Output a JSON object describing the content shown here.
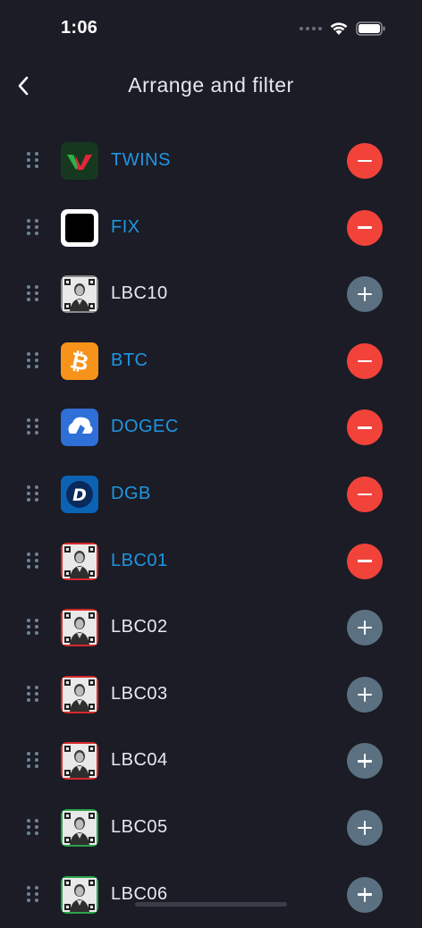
{
  "status": {
    "time": "1:06"
  },
  "header": {
    "title": "Arrange and filter"
  },
  "colors": {
    "active_text": "#1f96e3",
    "remove": "#f2433a",
    "add": "#5b7181",
    "background": "#1b1c26"
  },
  "coins": [
    {
      "name": "TWINS",
      "active": true,
      "icon": "twins-logo"
    },
    {
      "name": "FIX",
      "active": true,
      "icon": "fix-logo"
    },
    {
      "name": "LBC10",
      "active": false,
      "icon": "lbc-portrait"
    },
    {
      "name": "BTC",
      "active": true,
      "icon": "bitcoin-logo"
    },
    {
      "name": "DOGEC",
      "active": true,
      "icon": "dogec-logo"
    },
    {
      "name": "DGB",
      "active": true,
      "icon": "digibyte-logo"
    },
    {
      "name": "LBC01",
      "active": true,
      "icon": "lbc-portrait"
    },
    {
      "name": "LBC02",
      "active": false,
      "icon": "lbc-portrait"
    },
    {
      "name": "LBC03",
      "active": false,
      "icon": "lbc-portrait"
    },
    {
      "name": "LBC04",
      "active": false,
      "icon": "lbc-portrait"
    },
    {
      "name": "LBC05",
      "active": false,
      "icon": "lbc-portrait"
    },
    {
      "name": "LBC06",
      "active": false,
      "icon": "lbc-portrait"
    }
  ]
}
